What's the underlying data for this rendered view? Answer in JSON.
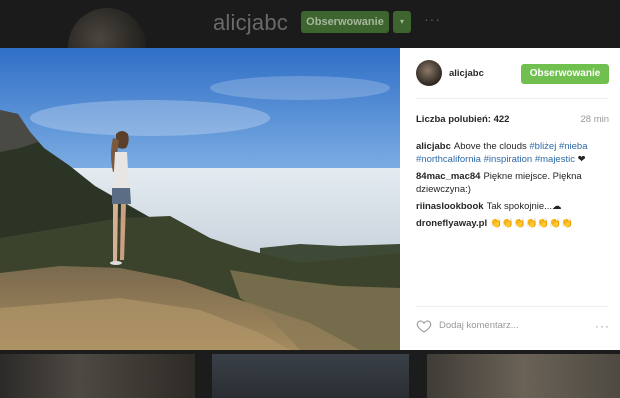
{
  "background": {
    "username": "alicjabc",
    "follow_label": "Obserwowanie",
    "dropdown_label": "▾",
    "more_label": "···"
  },
  "post": {
    "username": "alicjabc",
    "follow_label": "Obserwowanie",
    "likes": "Liczba polubień: 422",
    "time": "28 min",
    "caption": {
      "author": "alicjabc",
      "text": "Above the clouds",
      "tags": [
        "#bliżej",
        "#nieba",
        "#northcalifornia",
        "#inspiration",
        "#majestic"
      ],
      "emoji": "❤"
    },
    "comments": [
      {
        "author": "84mac_mac84",
        "text": "Piękne miejsce. Piękna dziewczyna:)"
      },
      {
        "author": "riinaslookbook",
        "text": "Tak spokojnie...☁"
      },
      {
        "author": "droneflyaway.pl",
        "text": "👏👏👏👏👏👏👏"
      }
    ],
    "add_comment_placeholder": "Dodaj komentarz...",
    "more_label": "···"
  },
  "colors": {
    "follow_green": "#70c050",
    "hashtag_blue": "#2e6aa7"
  }
}
